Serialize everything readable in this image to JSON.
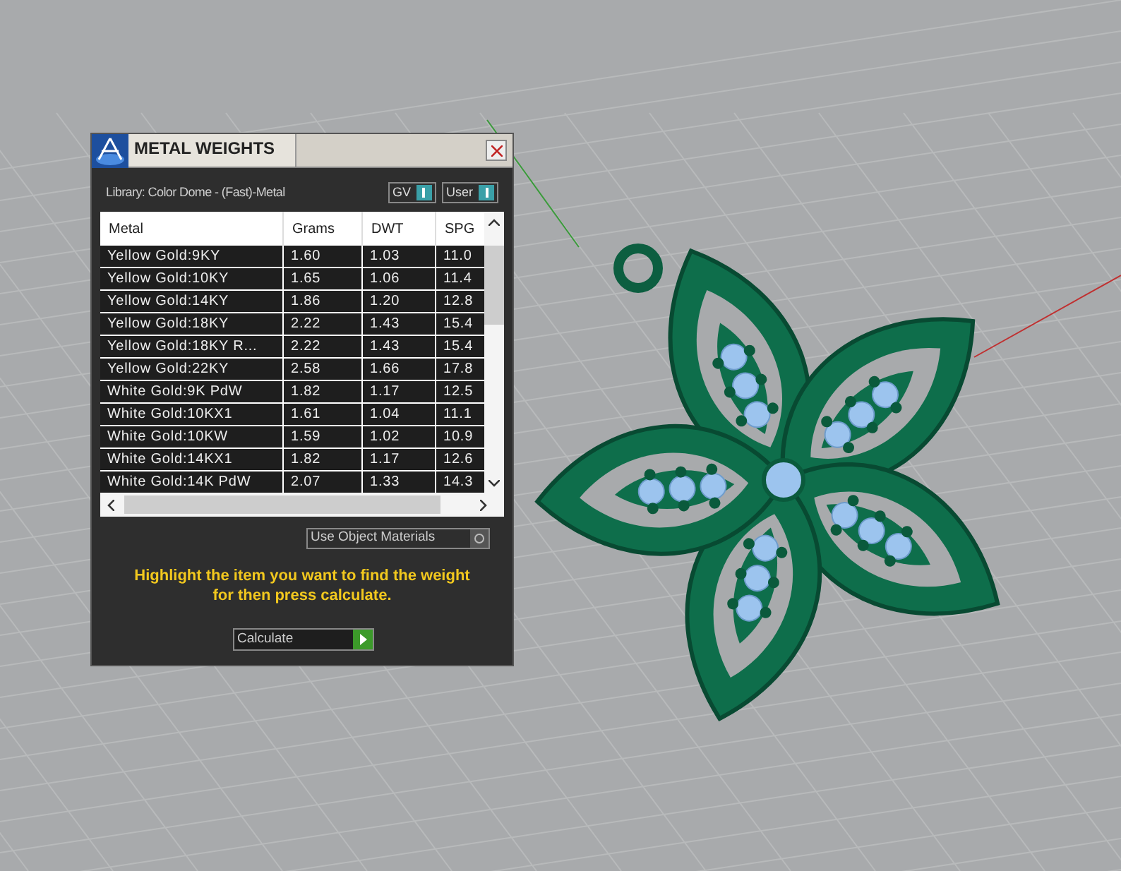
{
  "window": {
    "title": "METAL WEIGHTS"
  },
  "library": "Library: Color Dome - (Fast)-Metal",
  "toggles": [
    {
      "label": "GV",
      "on": true
    },
    {
      "label": "User",
      "on": true
    }
  ],
  "table": {
    "columns": [
      "Metal",
      "Grams",
      "DWT",
      "SPG"
    ],
    "rows": [
      {
        "cells": [
          "Yellow Gold:9KY",
          "1.60",
          "1.03",
          "11.0"
        ],
        "selected": false
      },
      {
        "cells": [
          "Yellow Gold:10KY",
          "1.65",
          "1.06",
          "11.4"
        ],
        "selected": false
      },
      {
        "cells": [
          "Yellow Gold:14KY",
          "1.86",
          "1.20",
          "12.8"
        ],
        "selected": false
      },
      {
        "cells": [
          "Yellow Gold:18KY",
          "2.22",
          "1.43",
          "15.4"
        ],
        "selected": false
      },
      {
        "cells": [
          "Yellow Gold:18KY R...",
          "2.22",
          "1.43",
          "15.4"
        ],
        "selected": false
      },
      {
        "cells": [
          "Yellow Gold:22KY",
          "2.58",
          "1.66",
          "17.8"
        ],
        "selected": false
      },
      {
        "cells": [
          "White Gold:9K PdW",
          "1.82",
          "1.17",
          "12.5"
        ],
        "selected": false
      },
      {
        "cells": [
          "White Gold:10KX1",
          "1.61",
          "1.04",
          "11.1"
        ],
        "selected": false
      },
      {
        "cells": [
          "White Gold:10KW",
          "1.59",
          "1.02",
          "10.9"
        ],
        "selected": false
      },
      {
        "cells": [
          "White Gold:14KX1",
          "1.82",
          "1.17",
          "12.6"
        ],
        "selected": false
      },
      {
        "cells": [
          "White Gold:14K PdW",
          "2.07",
          "1.33",
          "14.3"
        ],
        "selected": false
      }
    ]
  },
  "use_object_materials": {
    "label": "Use Object Materials",
    "on": false
  },
  "hint": "Highlight the item you want to find the weight for then press calculate.",
  "calculate_button": "Calculate"
}
